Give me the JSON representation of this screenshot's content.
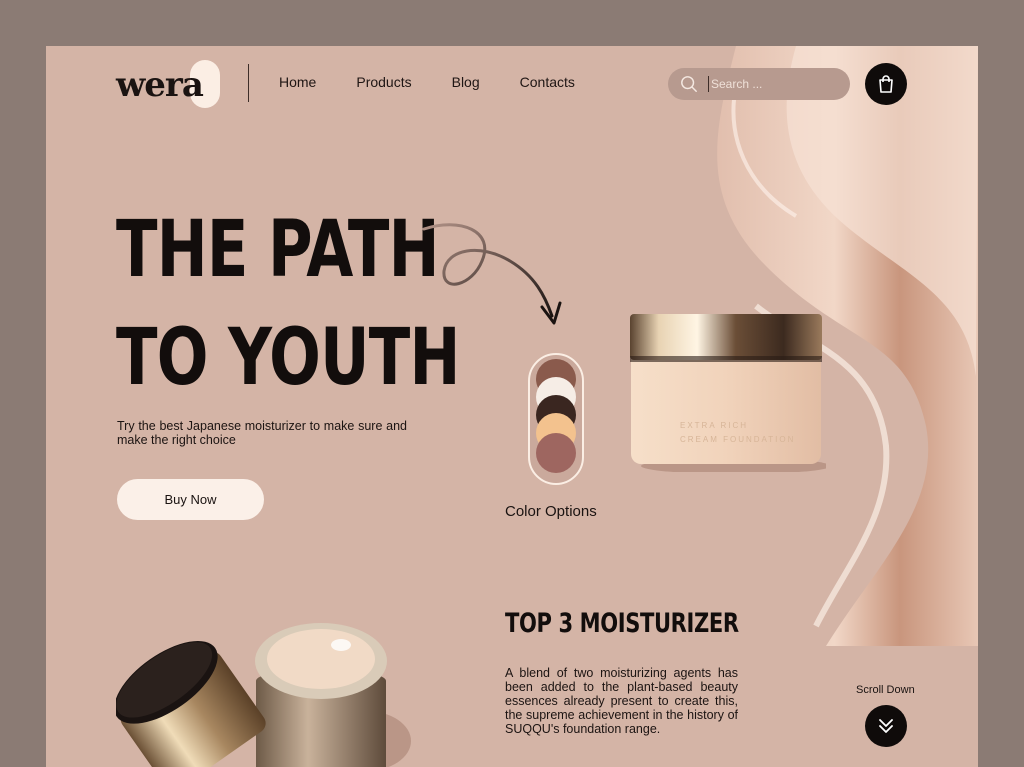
{
  "brand": {
    "logo_text": "wera"
  },
  "nav": {
    "items": [
      "Home",
      "Products",
      "Blog",
      "Contacts"
    ]
  },
  "search": {
    "placeholder": "Search ..."
  },
  "hero": {
    "headline_line1": "THE PATH",
    "headline_line2": "TO YOUTH",
    "tagline": "Try the best Japanese moisturizer to make sure and make the right choice",
    "cta_label": "Buy Now"
  },
  "color_options": {
    "label": "Color Options",
    "swatches": [
      "#8a5a4c",
      "#f6ede6",
      "#3a2620",
      "#f3c28e",
      "#9e6660"
    ]
  },
  "product": {
    "jar_label_line1": "EXTRA RICH",
    "jar_label_line2": "CREAM FOUNDATION"
  },
  "section": {
    "title": "TOP 3 MOISTURIZER",
    "text": "A blend of two moisturizing agents has been added to the plant-based beauty essences already present to create this, the supreme achievement in the history of SUQQU's foundation range."
  },
  "scroll": {
    "label": "Scroll Down"
  },
  "colors": {
    "background": "#d4b4a6",
    "dark": "#0f0b0a",
    "cream": "#fbf0e8"
  },
  "icons": {
    "search": "search-icon",
    "cart": "shopping-bag-icon",
    "scroll": "double-chevron-down-icon"
  }
}
